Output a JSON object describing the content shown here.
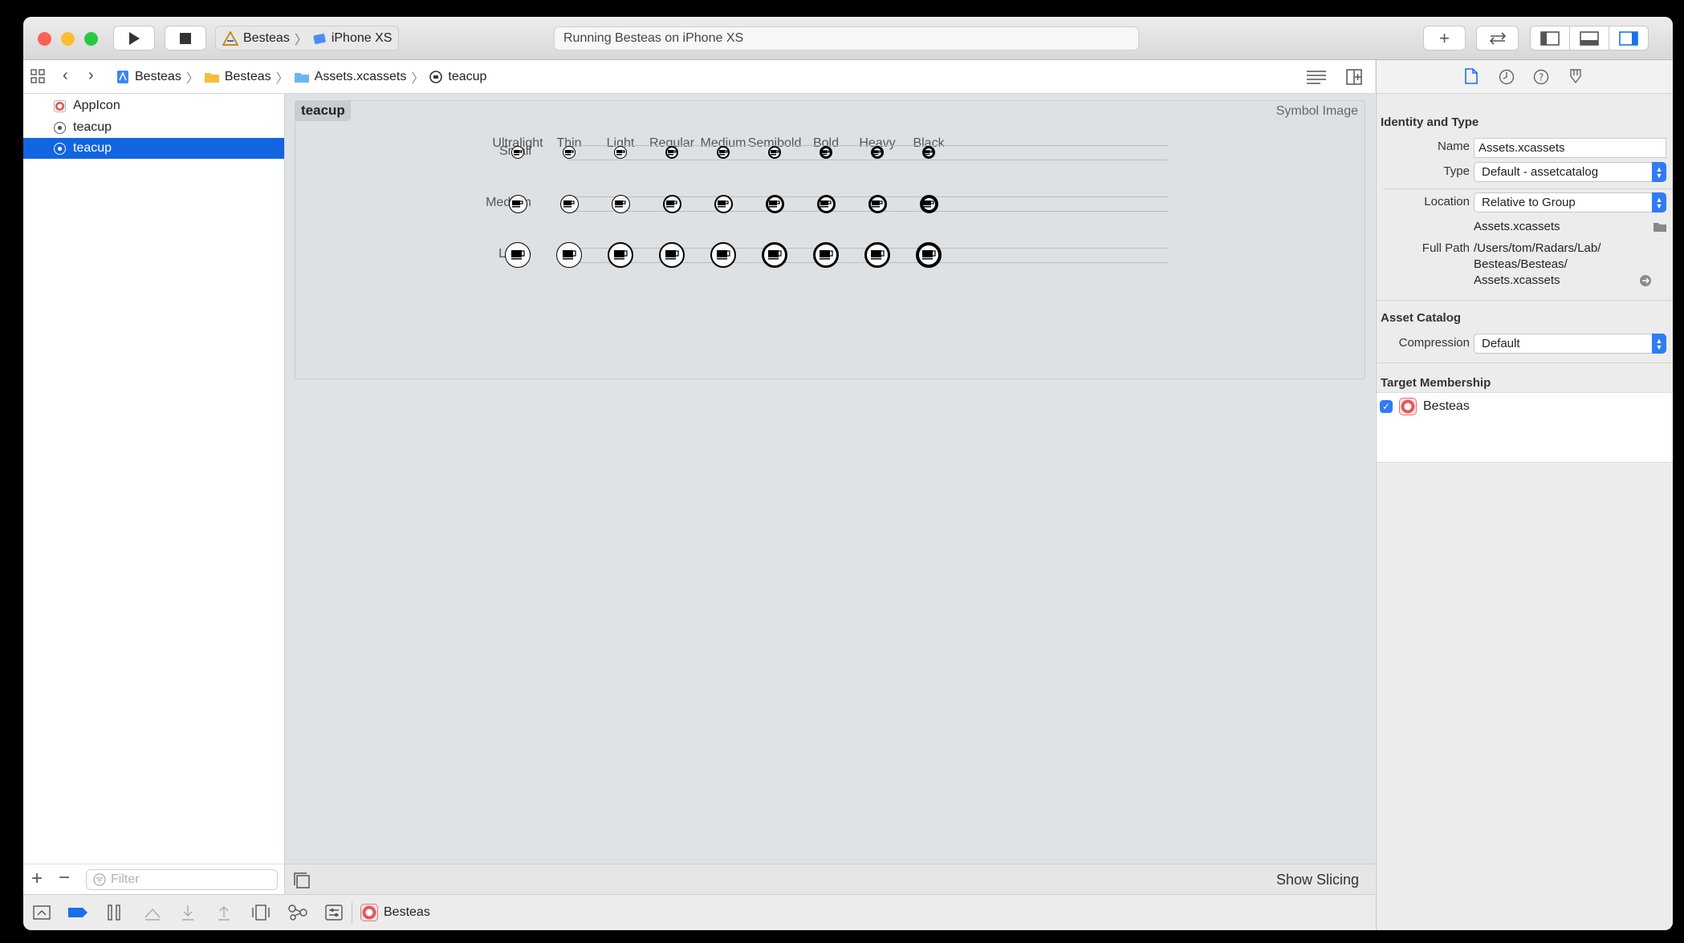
{
  "toolbar": {
    "scheme_target": "Besteas",
    "scheme_device": "iPhone XS",
    "activity_status": "Running Besteas on iPhone XS"
  },
  "jumpbar": {
    "crumbs": [
      "Besteas",
      "Besteas",
      "Assets.xcassets",
      "teacup"
    ]
  },
  "navigator": {
    "items": [
      {
        "label": "AppIcon",
        "selected": false
      },
      {
        "label": "teacup",
        "selected": false
      },
      {
        "label": "teacup",
        "selected": true
      }
    ],
    "filter_placeholder": "Filter"
  },
  "editor": {
    "asset_name": "teacup",
    "asset_kind": "Symbol Image",
    "weights": [
      "Ultralight",
      "Thin",
      "Light",
      "Regular",
      "Medium",
      "Semibold",
      "Bold",
      "Heavy",
      "Black"
    ],
    "scales": [
      "Small",
      "Medium",
      "Large"
    ],
    "show_slicing_label": "Show Slicing"
  },
  "debugbar": {
    "target_label": "Besteas"
  },
  "inspector": {
    "identity_title": "Identity and Type",
    "name_label": "Name",
    "name_value": "Assets.xcassets",
    "type_label": "Type",
    "type_value": "Default - assetcatalog",
    "location_label": "Location",
    "location_value": "Relative to Group",
    "location_file": "Assets.xcassets",
    "fullpath_label": "Full Path",
    "fullpath_lines": [
      "/Users/tom/Radars/Lab/",
      "Besteas/Besteas/",
      "Assets.xcassets"
    ],
    "catalog_title": "Asset Catalog",
    "compression_label": "Compression",
    "compression_value": "Default",
    "membership_title": "Target Membership",
    "membership_target": "Besteas",
    "membership_checked": true
  },
  "colors": {
    "selection": "#1165e0",
    "accent": "#2f7bf5",
    "close": "#fe5f57",
    "minimize": "#febc2e",
    "zoom": "#28c840"
  }
}
